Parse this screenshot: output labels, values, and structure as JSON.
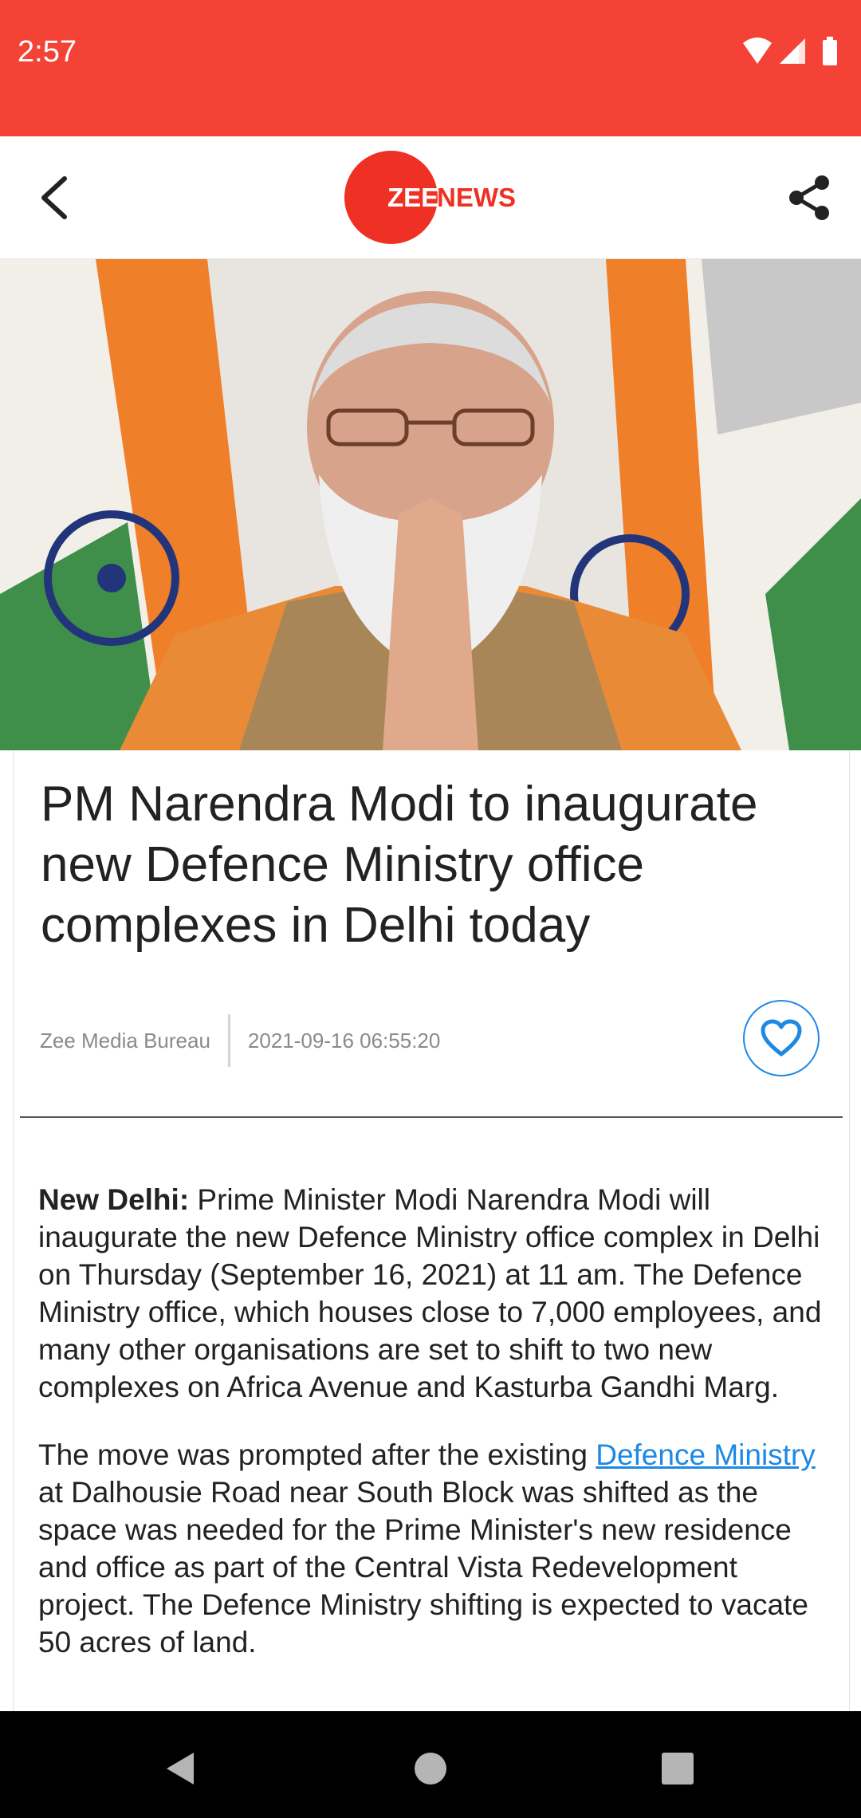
{
  "status_bar": {
    "time": "2:57",
    "icons": [
      "wifi-icon",
      "signal-icon",
      "battery-icon"
    ],
    "background": "#f44336"
  },
  "app_bar": {
    "logo_zee": "ZEE",
    "logo_news": "NEWS",
    "icons": [
      "back-arrow-icon",
      "share-icon"
    ],
    "brand_color": "#ee3124"
  },
  "article": {
    "headline": "PM Narendra Modi to inaugurate new Defence Ministry office complexes in Delhi today",
    "author": "Zee Media Bureau",
    "date": "2021-09-16 06:55:20",
    "favorite_icon": "heart-outline-icon",
    "paragraph1": {
      "lead": "New Delhi:",
      "text": " Prime Minister Modi Narendra Modi will inaugurate the new Defence Ministry office complex in Delhi on Thursday (September 16, 2021) at 11 am. The Defence Ministry office, which houses close to 7,000 employees, and many other organisations are set to shift to two new complexes on Africa Avenue and Kasturba Gandhi Marg."
    },
    "paragraph2": {
      "before": "The move was prompted after the existing ",
      "link": "Defence Ministry",
      "after": " at Dalhousie Road near South Block was shifted as the space was needed for the Prime Minister's new residence and office as part of the Central Vista Redevelopment project. The Defence Ministry shifting is expected to vacate 50 acres of land."
    },
    "link_color": "#1e88e5"
  },
  "nav_bar": {
    "icons": [
      "nav-back-icon",
      "nav-home-icon",
      "nav-recents-icon"
    ]
  }
}
